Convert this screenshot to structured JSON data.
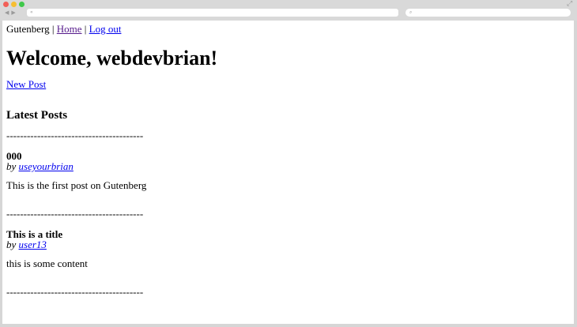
{
  "browser": {
    "address_text": "«",
    "search_text": "⌕"
  },
  "nav": {
    "site_name": "Gutenberg",
    "sep1": " | ",
    "home_label": "Home",
    "sep2": " | ",
    "logout_label": "Log out"
  },
  "page": {
    "heading": "Welcome, webdevbrian!",
    "new_post_label": "New Post",
    "latest_heading": "Latest Posts",
    "divider": "----------------------------------------"
  },
  "posts": [
    {
      "title": "000",
      "by": "by ",
      "author": "useyourbrian",
      "body": "This is the first post on Gutenberg"
    },
    {
      "title": "This is a title",
      "by": "by ",
      "author": "user13",
      "body": "this is some content"
    }
  ]
}
